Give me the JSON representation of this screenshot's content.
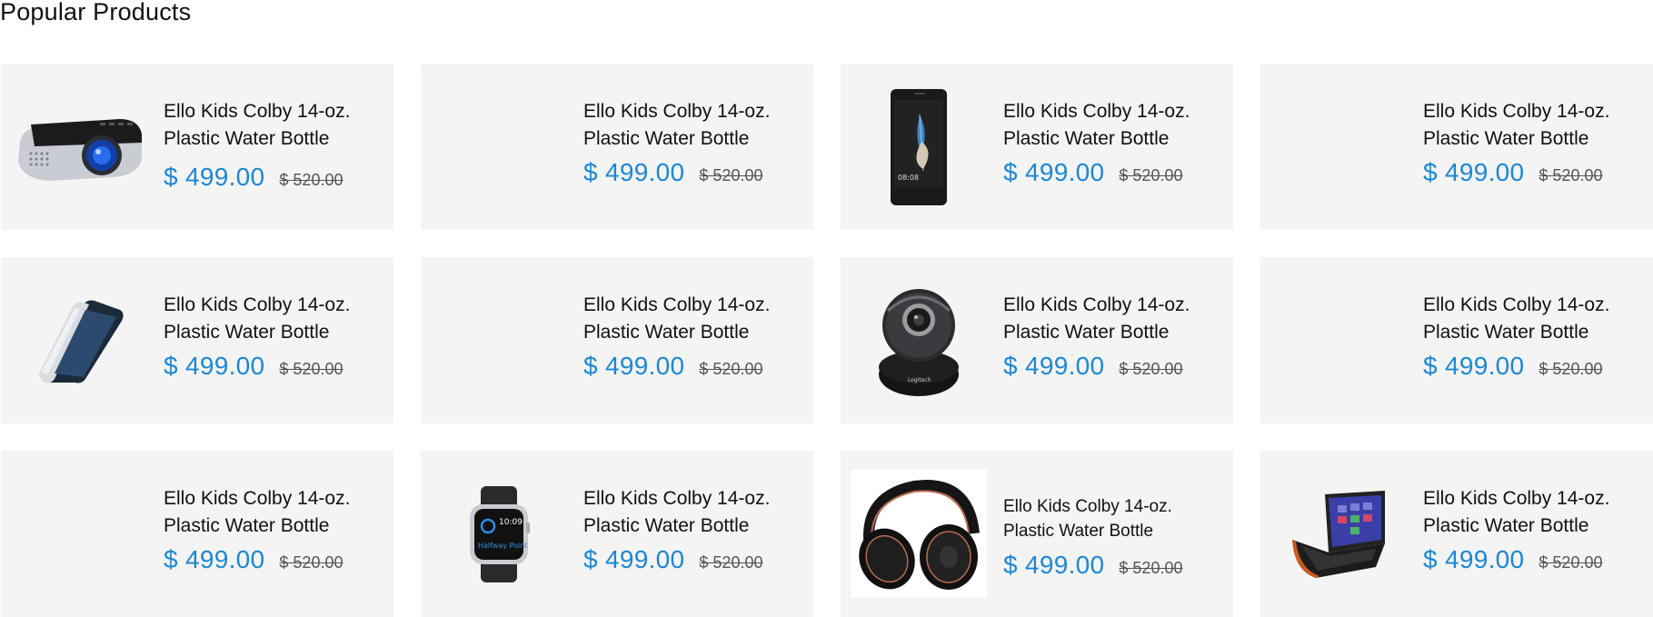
{
  "section": {
    "title": "Popular Products"
  },
  "colors": {
    "price": "#1c87d6",
    "card_background": "#f4f4f4"
  },
  "products": [
    {
      "title_line1": "Ello Kids Colby 14-oz.",
      "title_line2": "Plastic Water Bottle",
      "price": "$ 499.00",
      "old_price": "$ 520.00",
      "image": "projector-image"
    },
    {
      "title_line1": "Ello Kids Colby 14-oz.",
      "title_line2": "Plastic Water Bottle",
      "price": "$ 499.00",
      "old_price": "$ 520.00",
      "image": ""
    },
    {
      "title_line1": "Ello Kids Colby 14-oz.",
      "title_line2": "Plastic Water Bottle",
      "price": "$ 499.00",
      "old_price": "$ 520.00",
      "image": "smartphone-feather-image"
    },
    {
      "title_line1": "Ello Kids Colby 14-oz.",
      "title_line2": "Plastic Water Bottle",
      "price": "$ 499.00",
      "old_price": "$ 520.00",
      "image": ""
    },
    {
      "title_line1": "Ello Kids Colby 14-oz.",
      "title_line2": "Plastic Water Bottle",
      "price": "$ 499.00",
      "old_price": "$ 520.00",
      "image": "galaxy-phone-image"
    },
    {
      "title_line1": "Ello Kids Colby 14-oz.",
      "title_line2": "Plastic Water Bottle",
      "price": "$ 499.00",
      "old_price": "$ 520.00",
      "image": ""
    },
    {
      "title_line1": "Ello Kids Colby 14-oz.",
      "title_line2": "Plastic Water Bottle",
      "price": "$ 499.00",
      "old_price": "$ 520.00",
      "image": "webcam-image"
    },
    {
      "title_line1": "Ello Kids Colby 14-oz.",
      "title_line2": "Plastic Water Bottle",
      "price": "$ 499.00",
      "old_price": "$ 520.00",
      "image": ""
    },
    {
      "title_line1": "Ello Kids Colby 14-oz.",
      "title_line2": "Plastic Water Bottle",
      "price": "$ 499.00",
      "old_price": "$ 520.00",
      "image": ""
    },
    {
      "title_line1": "Ello Kids Colby 14-oz.",
      "title_line2": "Plastic Water Bottle",
      "price": "$ 499.00",
      "old_price": "$ 520.00",
      "image": "smartwatch-image",
      "watch_time": "10:09",
      "watch_text": "Halfway Point"
    },
    {
      "title_line1": "Ello Kids Colby 14-oz.",
      "title_line2": "Plastic Water Bottle",
      "price": "$ 499.00",
      "old_price": "$ 520.00",
      "image": "headphones-image"
    },
    {
      "title_line1": "Ello Kids Colby 14-oz.",
      "title_line2": "Plastic Water Bottle",
      "price": "$ 499.00",
      "old_price": "$ 520.00",
      "image": "laptop-image"
    }
  ]
}
